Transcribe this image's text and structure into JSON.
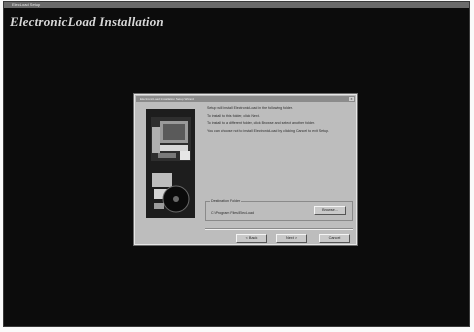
{
  "window": {
    "titlebar_text": "ElecLoad Setup"
  },
  "installer": {
    "title": "ElectronicLoad Installation"
  },
  "dialog": {
    "title": "ElectronicLoad Installation Setup Wizard",
    "close_label": "x",
    "instructions": [
      "Setup will install ElectronicLoad in the following folder.",
      "To install to this folder, click Next.",
      "To install to a different folder, click Browse and select another folder.",
      "You can choose not to install ElectronicLoad by clicking Cancel to exit Setup."
    ],
    "destination_label": "Destination Folder",
    "destination_path": "C:\\Program Files\\ElecLoad",
    "browse_label": "Browse...",
    "back_label": "< Back",
    "next_label": "Next >",
    "cancel_label": "Cancel"
  },
  "colors": {
    "background": "#0c0c0c",
    "dialog": "#bdbdbd",
    "title_text": "#d8d8d8"
  }
}
